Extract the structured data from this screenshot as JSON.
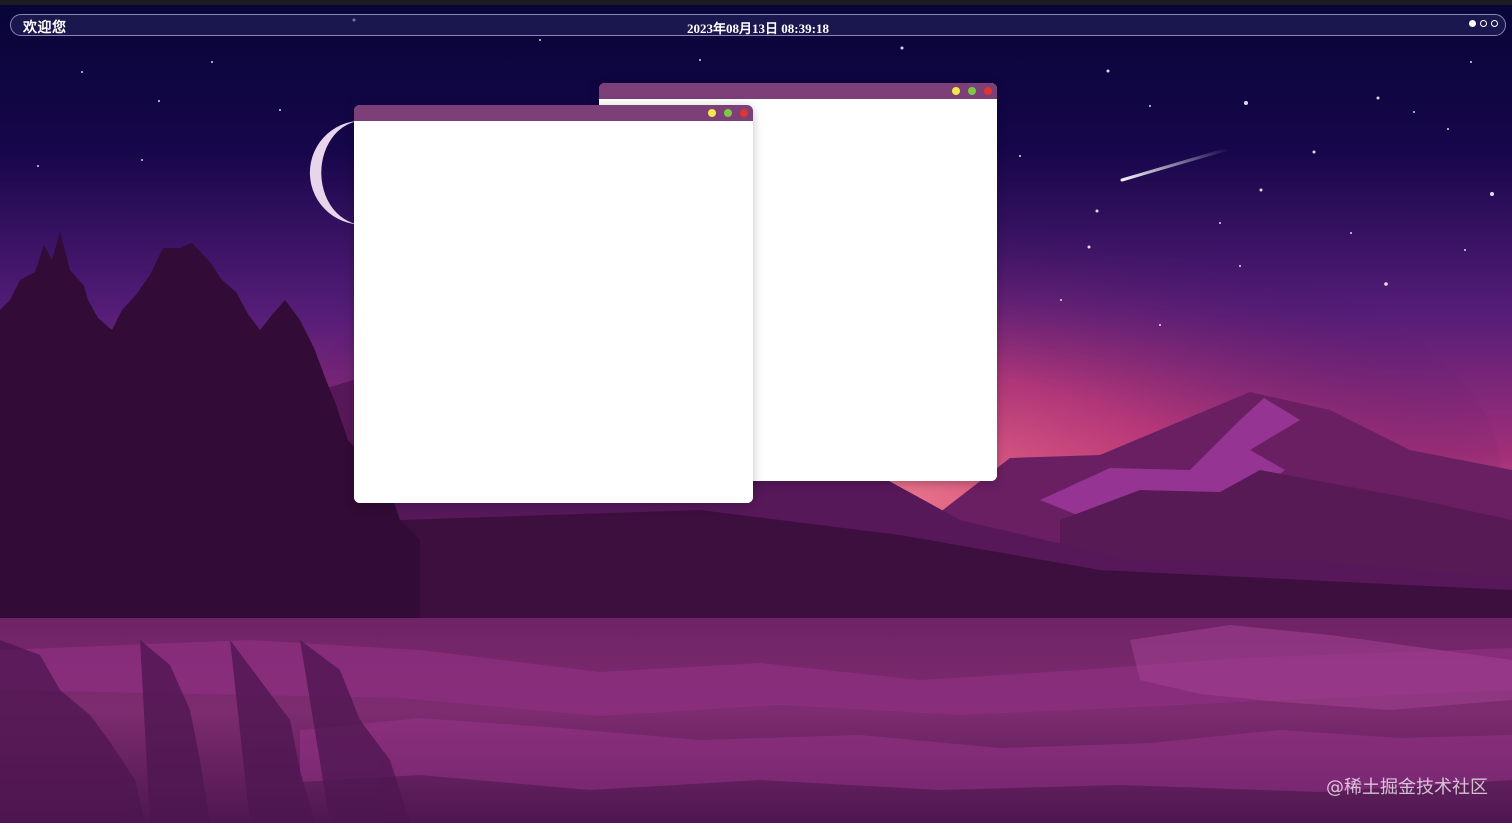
{
  "topbar": {
    "welcome": "欢迎您",
    "clock": "2023年08月13日 08:39:18",
    "workspace_dots": [
      {
        "active": true
      },
      {
        "active": false
      },
      {
        "active": false
      }
    ]
  },
  "windows": [
    {
      "name": "back-window",
      "title": ""
    },
    {
      "name": "front-window",
      "title": ""
    }
  ],
  "watermark": "@稀土掘金技术社区",
  "colors": {
    "titlebar": "#7c3f78",
    "minimize": "#f3e84b",
    "maximize": "#7ac943",
    "close": "#e0352f",
    "sky_top": "#08073a",
    "sky_glow": "#e4557f",
    "mountain": "#5a1c5c",
    "water": "#7a2566"
  },
  "icons": {
    "minimize": "minimize-icon",
    "maximize": "maximize-icon",
    "close": "close-icon"
  }
}
